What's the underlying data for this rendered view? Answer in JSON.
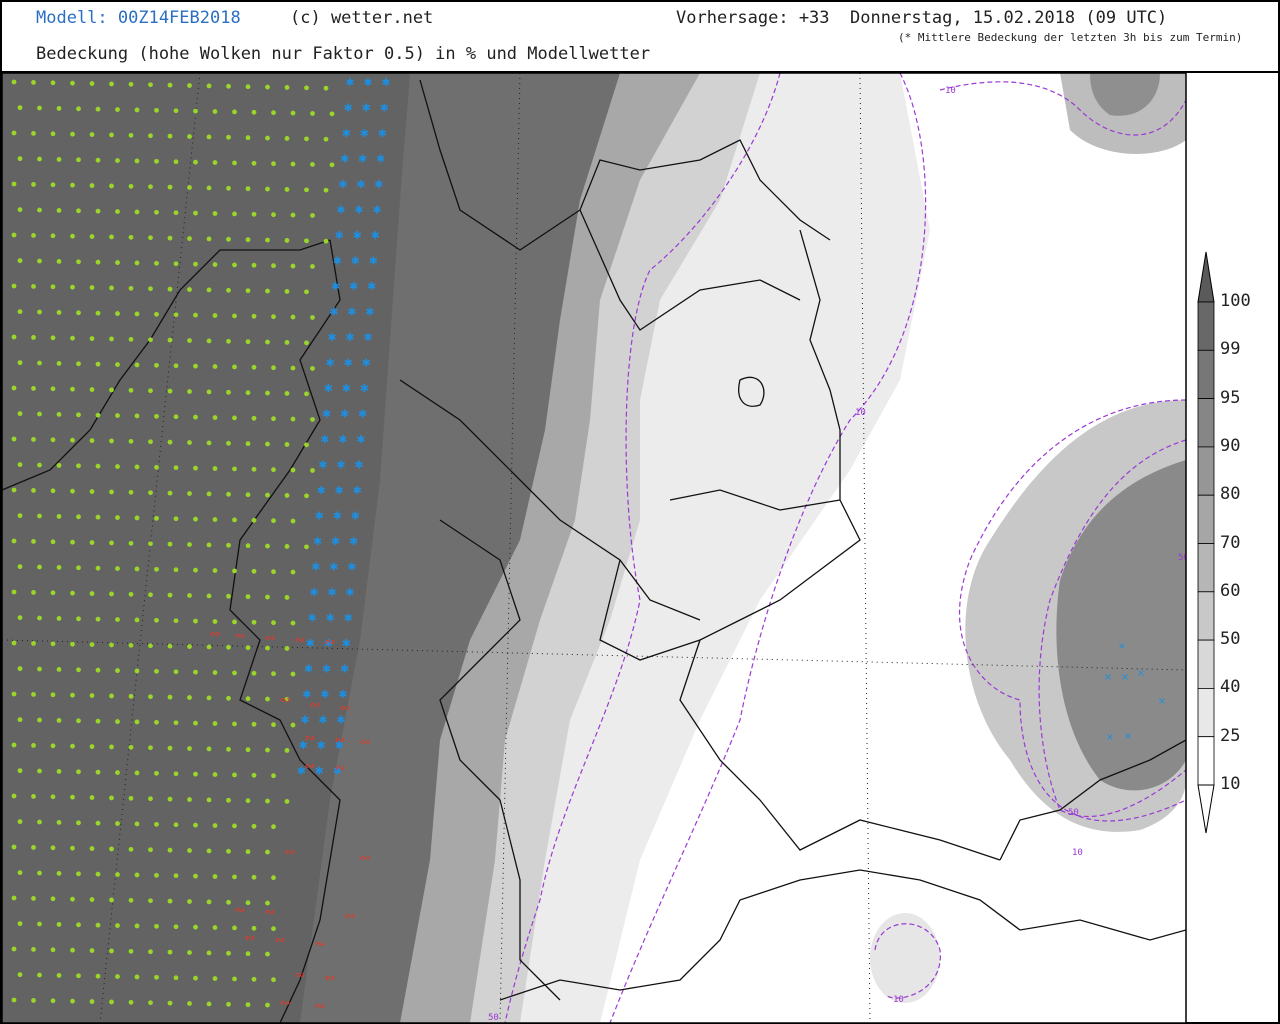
{
  "header": {
    "model": "Modell: 00Z14FEB2018",
    "copyright": "(c) wetter.net",
    "forecast": "Vorhersage: +33  Donnerstag, 15.02.2018 (09 UTC)",
    "footnote": "(* Mittlere Bedeckung der letzten 3h bis zum Termin)",
    "title": "Bedeckung (hohe Wolken nur Faktor 0.5) in % und Modellwetter"
  },
  "legend": {
    "levels": [
      "100",
      "99",
      "95",
      "90",
      "80",
      "70",
      "60",
      "50",
      "40",
      "25",
      "10"
    ],
    "colors": [
      "#5a5a5a",
      "#686868",
      "#777777",
      "#868686",
      "#969696",
      "#a6a6a6",
      "#b6b6b6",
      "#c8c8c8",
      "#d8d8d8",
      "#e8e8e8",
      "#ffffff"
    ]
  },
  "map": {
    "contour_labels": [
      "10",
      "10",
      "10",
      "10",
      "50",
      "50",
      "50"
    ],
    "colors": {
      "overcast": "#6f6f6f",
      "dark_cloud": "#606060",
      "rain_symbol": "#9ad62a",
      "snow_symbol": "#1e8fe0",
      "freezing_symbol": "#e03a2a",
      "contour": "#9a3ad4",
      "border": "#111111"
    }
  }
}
